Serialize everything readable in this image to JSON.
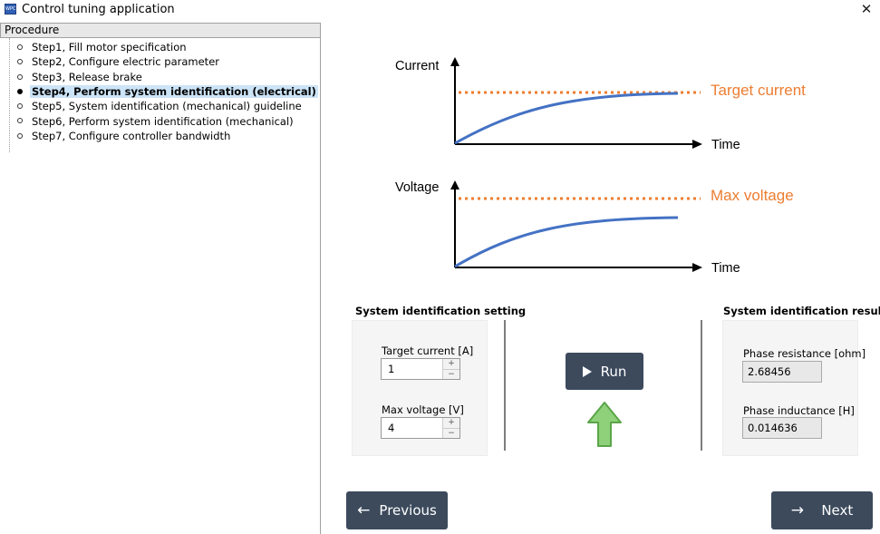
{
  "window": {
    "title": "Control tuning application",
    "icon_text": "WPC",
    "close_glyph": "✕"
  },
  "procedure": {
    "header": "Procedure",
    "steps": [
      {
        "label": "Step1, Fill motor specification",
        "active": false
      },
      {
        "label": "Step2, Configure electric parameter",
        "active": false
      },
      {
        "label": "Step3, Release brake",
        "active": false
      },
      {
        "label": "Step4, Perform system identification (electrical)",
        "active": true
      },
      {
        "label": "Step5, System identification (mechanical) guideline",
        "active": false
      },
      {
        "label": "Step6, Perform system identification (mechanical)",
        "active": false
      },
      {
        "label": "Step7, Configure controller bandwidth",
        "active": false
      }
    ]
  },
  "diagram": {
    "current_axis": "Current",
    "voltage_axis": "Voltage",
    "time_label": "Time",
    "target_label": "Target current",
    "max_label": "Max voltage",
    "curve_color": "#4472c4",
    "limit_color": "#ed7d31"
  },
  "settings": {
    "title": "System identification setting",
    "target_current_label": "Target current [A]",
    "target_current_value": "1",
    "max_voltage_label": "Max voltage [V]",
    "max_voltage_value": "4",
    "spin_up": "+",
    "spin_down": "−"
  },
  "run": {
    "label": "Run",
    "hint_arrow_color": "#7ec26c"
  },
  "result": {
    "title": "System identification result",
    "phase_resistance_label": "Phase resistance [ohm]",
    "phase_resistance_value": "2.68456",
    "phase_inductance_label": "Phase inductance [H]",
    "phase_inductance_value": "0.014636"
  },
  "navigation": {
    "previous_label": "Previous",
    "previous_arrow": "←",
    "next_label": "Next",
    "next_arrow": "→"
  },
  "colors": {
    "button_bg": "#3c4a5c",
    "selected_bg": "#cce4f7"
  }
}
